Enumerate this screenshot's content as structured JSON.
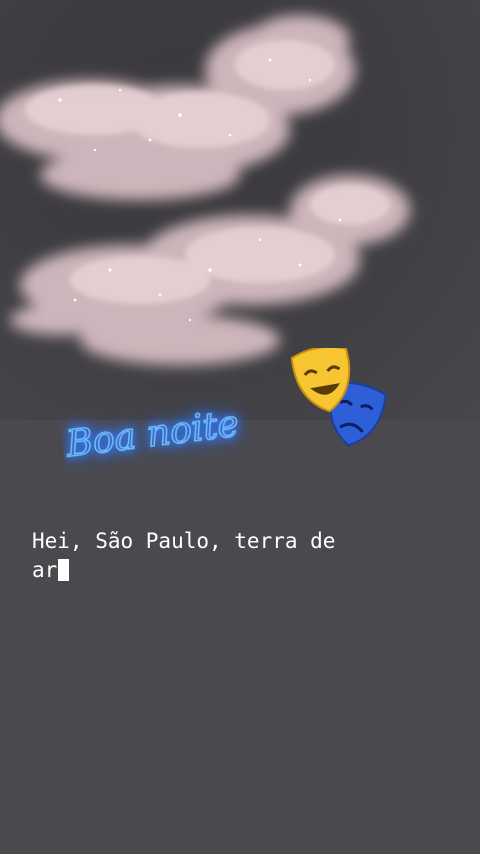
{
  "story": {
    "sticker_text": "Boa noite",
    "caption_line1": "Hei, São Paulo, terra de",
    "caption_line2": "ar",
    "sticker_icon": "performing-arts-masks-icon",
    "colors": {
      "background": "#4a494e",
      "cloud": "#e7d3d6",
      "neon": "#6fb9ff",
      "caption": "#ffffff"
    }
  }
}
